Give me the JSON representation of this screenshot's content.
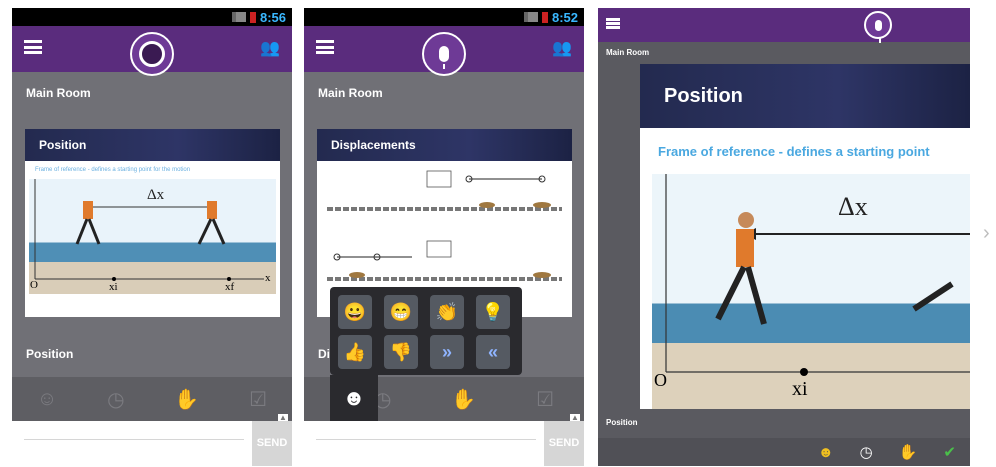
{
  "screens": [
    {
      "time": "8:56",
      "room": "Main Room",
      "slide_title": "Position",
      "slide_subtitle": "Frame of reference - defines a starting point for the motion",
      "diagram": {
        "delta": "Δx",
        "origin": "O",
        "xi": "xi",
        "xf": "xf",
        "axis": "x"
      },
      "next_title": "Position",
      "send": "SEND"
    },
    {
      "time": "8:52",
      "room": "Main Room",
      "slide_title": "Displacements",
      "next_title": "Dis",
      "send": "SEND",
      "emoji_grid": [
        "😀",
        "😁",
        "👏",
        "💡",
        "👍",
        "👎",
        "»",
        "«"
      ]
    },
    {
      "room": "Main Room",
      "slide_title": "Position",
      "slide_subtitle": "Frame of reference - defines a starting point",
      "diagram": {
        "delta": "Δx",
        "origin": "O",
        "xi": "xi"
      },
      "footer_title": "Position"
    }
  ],
  "icons": [
    "menu-icon",
    "people-icon",
    "microphone-icon",
    "record-icon",
    "smiley-icon",
    "clock-icon",
    "hand-icon",
    "check-icon",
    "chevron-right-icon"
  ],
  "colors": {
    "appbar": "#5a2c7d",
    "body": "#707076",
    "accent_text": "#4aa8e0"
  }
}
